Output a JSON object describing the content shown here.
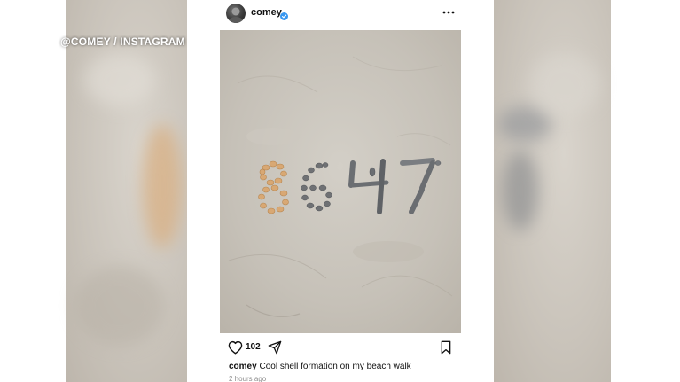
{
  "watermark": "@COMEY / INSTAGRAM",
  "post": {
    "username": "comey",
    "verified": true,
    "more_icon": "more-horizontal-icon",
    "photo_subject": "8647",
    "like_count": "102",
    "caption_user": "comey",
    "caption_text": "Cool shell formation on my beach walk",
    "timestamp": "2 hours ago"
  },
  "icons": {
    "like": "heart-icon",
    "share": "send-icon",
    "save": "bookmark-icon",
    "verified": "verified-badge-icon"
  },
  "colors": {
    "verified_blue": "#3897f0",
    "sand": "#c9c4bb",
    "shells": "#d8a874",
    "stones": "#6f7174"
  }
}
